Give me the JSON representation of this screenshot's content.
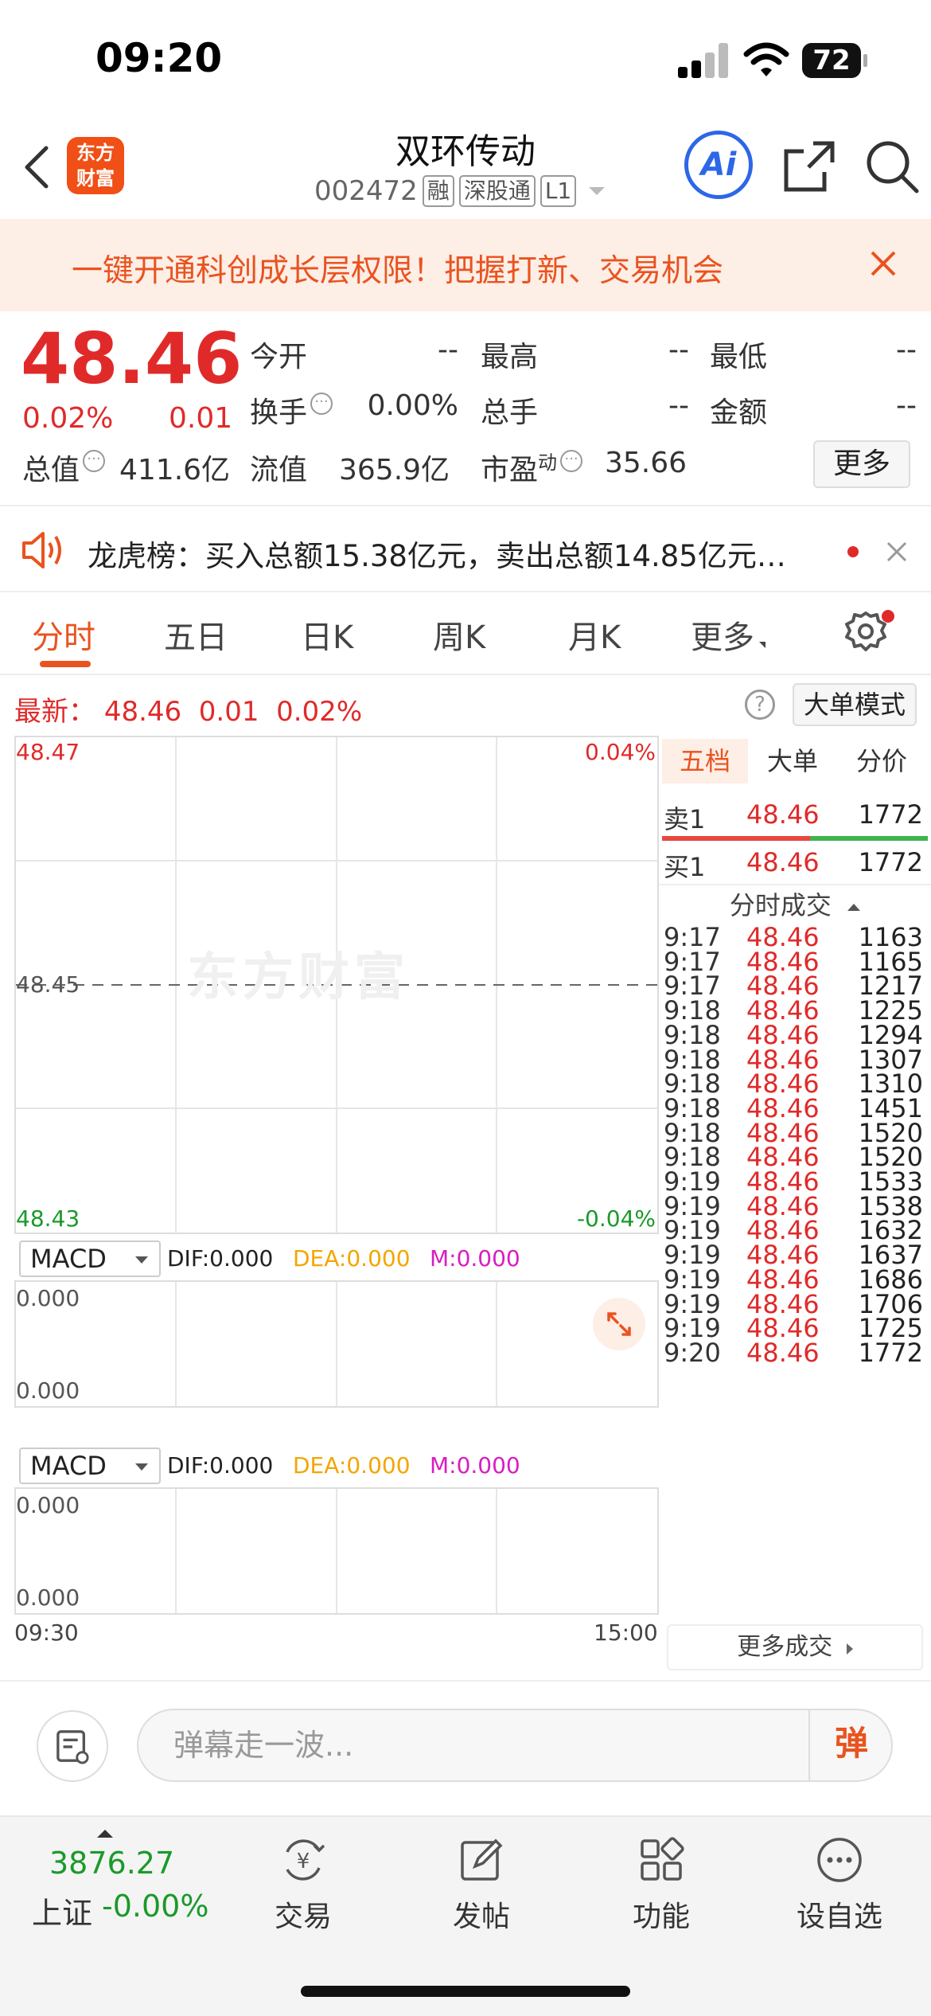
{
  "status_bar": {
    "time": "09:20",
    "battery": "72"
  },
  "header": {
    "logo_line1": "东方",
    "logo_line2": "财富",
    "stock_name": "双环传动",
    "stock_code": "002472",
    "tags": [
      "融",
      "深股通",
      "L1"
    ],
    "ai_label": "Ai"
  },
  "banner": {
    "text": "一键开通科创成长层权限！把握打新、交易机会"
  },
  "quote": {
    "price": "48.46",
    "change_pct": "0.02%",
    "change_abs": "0.01",
    "fields": {
      "open_label": "今开",
      "open_value": "--",
      "high_label": "最高",
      "high_value": "--",
      "low_label": "最低",
      "low_value": "--",
      "turnover_label": "换手",
      "turnover_value": "0.00%",
      "volume_label": "总手",
      "volume_value": "--",
      "amount_label": "金额",
      "amount_value": "--",
      "mktcap_label": "总值",
      "mktcap_value": "411.6亿",
      "float_label": "流值",
      "float_value": "365.9亿",
      "pe_label": "市盈",
      "pe_sup": "动",
      "pe_value": "35.66"
    },
    "more_label": "更多"
  },
  "dragon_tiger": {
    "text": "龙虎榜：买入总额15.38亿元，卖出总额14.85亿元…"
  },
  "tabs": [
    "分时",
    "五日",
    "日K",
    "周K",
    "月K",
    "更多"
  ],
  "latest": {
    "label": "最新：",
    "price": "48.46",
    "change": "0.01",
    "pct": "0.02%",
    "bigorder_label": "大单模式",
    "help": "?"
  },
  "chart": {
    "y_top": "48.47",
    "y_mid": "48.45",
    "y_bottom": "48.43",
    "pct_top": "0.04%",
    "pct_bottom": "-0.04%",
    "watermark": "东方财富",
    "time_start": "09:30",
    "time_end": "15:00",
    "indicators": [
      {
        "name": "MACD",
        "dif": "DIF:0.000",
        "dea": "DEA:0.000",
        "m": "M:0.000",
        "top": "0.000",
        "bottom": "0.000"
      },
      {
        "name": "MACD",
        "dif": "DIF:0.000",
        "dea": "DEA:0.000",
        "m": "M:0.000",
        "top": "0.000",
        "bottom": "0.000"
      }
    ]
  },
  "order_book": {
    "tabs": [
      "五档",
      "大单",
      "分价"
    ],
    "sell1": {
      "label": "卖1",
      "price": "48.46",
      "vol": "1772"
    },
    "buy1": {
      "label": "买1",
      "price": "48.46",
      "vol": "1772"
    },
    "ticks_title": "分时成交",
    "ticks": [
      {
        "time": "9:17",
        "price": "48.46",
        "vol": "1163"
      },
      {
        "time": "9:17",
        "price": "48.46",
        "vol": "1165"
      },
      {
        "time": "9:17",
        "price": "48.46",
        "vol": "1217"
      },
      {
        "time": "9:18",
        "price": "48.46",
        "vol": "1225"
      },
      {
        "time": "9:18",
        "price": "48.46",
        "vol": "1294"
      },
      {
        "time": "9:18",
        "price": "48.46",
        "vol": "1307"
      },
      {
        "time": "9:18",
        "price": "48.46",
        "vol": "1310"
      },
      {
        "time": "9:18",
        "price": "48.46",
        "vol": "1451"
      },
      {
        "time": "9:18",
        "price": "48.46",
        "vol": "1520"
      },
      {
        "time": "9:18",
        "price": "48.46",
        "vol": "1520"
      },
      {
        "time": "9:19",
        "price": "48.46",
        "vol": "1533"
      },
      {
        "time": "9:19",
        "price": "48.46",
        "vol": "1538"
      },
      {
        "time": "9:19",
        "price": "48.46",
        "vol": "1632"
      },
      {
        "time": "9:19",
        "price": "48.46",
        "vol": "1637"
      },
      {
        "time": "9:19",
        "price": "48.46",
        "vol": "1686"
      },
      {
        "time": "9:19",
        "price": "48.46",
        "vol": "1706"
      },
      {
        "time": "9:19",
        "price": "48.46",
        "vol": "1725"
      },
      {
        "time": "9:20",
        "price": "48.46",
        "vol": "1772"
      }
    ],
    "more_deals": "更多成交"
  },
  "comment": {
    "placeholder": "弹幕走一波...",
    "danmu_label": "弹"
  },
  "bottom_nav": {
    "index_value": "3876.27",
    "index_name": "上证",
    "index_change": "-0.00%",
    "items": [
      "交易",
      "发帖",
      "功能",
      "设自选"
    ]
  },
  "colors": {
    "up": "#e02a2a",
    "down": "#1a9a2a",
    "accent": "#e9531f",
    "ai_blue": "#2d67e8"
  }
}
